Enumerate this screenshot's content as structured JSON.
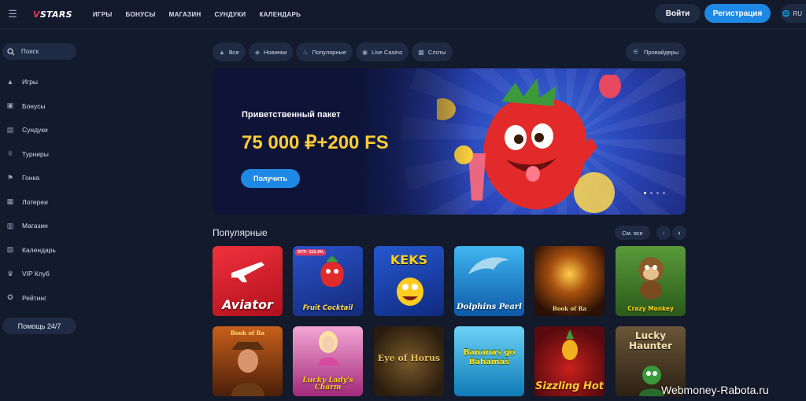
{
  "header": {
    "logo_mark": "V",
    "logo_text": "STARS",
    "nav": [
      "ИГРЫ",
      "БОНУСЫ",
      "МАГАЗИН",
      "СУНДУКИ",
      "КАЛЕНДАРЬ"
    ],
    "login_label": "Войти",
    "register_label": "Регистрация",
    "lang": "RU"
  },
  "sidebar": {
    "search_placeholder": "Поиск",
    "items": [
      {
        "label": "Игры",
        "icon": "fire-icon"
      },
      {
        "label": "Бонусы",
        "icon": "gift-icon"
      },
      {
        "label": "Сундуки",
        "icon": "chest-icon"
      },
      {
        "label": "Турниры",
        "icon": "trophy-icon"
      },
      {
        "label": "Гонка",
        "icon": "flag-icon"
      },
      {
        "label": "Лотереи",
        "icon": "ticket-icon"
      },
      {
        "label": "Магазин",
        "icon": "shop-icon"
      },
      {
        "label": "Календарь",
        "icon": "calendar-icon"
      },
      {
        "label": "VIP Клуб",
        "icon": "crown-icon"
      },
      {
        "label": "Рейтинг",
        "icon": "medal-icon"
      }
    ],
    "help_label": "Помощь 24/7"
  },
  "categories": [
    {
      "label": "Все",
      "icon": "fire-icon"
    },
    {
      "label": "Новинки",
      "icon": "cube-icon"
    },
    {
      "label": "Популярные",
      "icon": "flame-icon"
    },
    {
      "label": "Live Casino",
      "icon": "chip-icon"
    },
    {
      "label": "Слоты",
      "icon": "slots-icon"
    }
  ],
  "providers_label": "Провайдеры",
  "banner": {
    "subtitle": "Приветственный пакет",
    "title": "75 000 ₽+200 FS",
    "cta_label": "Получить",
    "slides": 4,
    "active_slide": 1
  },
  "popular": {
    "title": "Популярные",
    "see_all_label": "См. все",
    "games": [
      {
        "name": "Aviator",
        "bg": "#d8202f"
      },
      {
        "name": "Fruit Cocktail",
        "bg": "#1f3aa8",
        "badge": "RTP: 113.4%"
      },
      {
        "name": "KEKS",
        "bg": "#1c47b8"
      },
      {
        "name": "Dolphins Pearl",
        "bg": "#1c8fd6"
      },
      {
        "name": "Book of Ra",
        "bg": "#3a1f0e"
      },
      {
        "name": "Crazy Monkey",
        "bg": "#3c7a2a"
      },
      {
        "name": "Book of Ra",
        "bg": "#5a2a10"
      },
      {
        "name": "Lucky Lady's Charm",
        "bg": "#c94d9c"
      },
      {
        "name": "Eye of Horus",
        "bg": "#3a2a18"
      },
      {
        "name": "Bananas go Bahamas",
        "bg": "#1c9ad0"
      },
      {
        "name": "Sizzling Hot",
        "bg": "#6a0e14"
      },
      {
        "name": "Lucky Haunter",
        "bg": "#4a3a26"
      }
    ]
  },
  "watermark": "Webmoney-Rabota.ru"
}
